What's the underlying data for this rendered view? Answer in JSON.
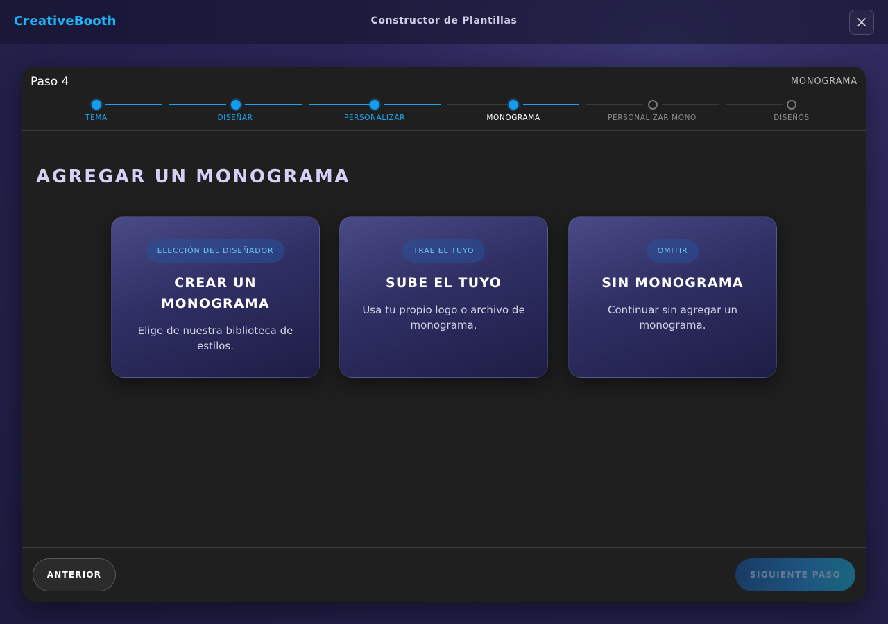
{
  "app": {
    "brand": "CreativeBooth",
    "title": "Constructor de Plantillas"
  },
  "wizard": {
    "step_label": "Paso 4",
    "current_step_name": "MONOGRAMA",
    "steps": [
      {
        "label": "TEMA",
        "state": "done"
      },
      {
        "label": "DISEÑAR",
        "state": "done"
      },
      {
        "label": "PERSONALIZAR",
        "state": "done"
      },
      {
        "label": "MONOGRAMA",
        "state": "active"
      },
      {
        "label": "PERSONALIZAR MONO",
        "state": "pending"
      },
      {
        "label": "DISEÑOS",
        "state": "pending"
      }
    ]
  },
  "main": {
    "heading": "AGREGAR UN MONOGRAMA",
    "options": [
      {
        "badge": "ELECCIÓN DEL DISEÑADOR",
        "title": "CREAR UN MONOGRAMA",
        "description": "Elige de nuestra biblioteca de estilos."
      },
      {
        "badge": "TRAE EL TUYO",
        "title": "SUBE EL TUYO",
        "description": "Usa tu propio logo o archivo de monograma."
      },
      {
        "badge": "OMITIR",
        "title": "SIN MONOGRAMA",
        "description": "Continuar sin agregar un monograma."
      }
    ]
  },
  "footer": {
    "prev_label": "ANTERIOR",
    "next_label": "SIGUIENTE PASO"
  },
  "colors": {
    "accent": "#1ca7f0",
    "brand": "#1fb5f5",
    "panel": "#1f1f1f"
  }
}
